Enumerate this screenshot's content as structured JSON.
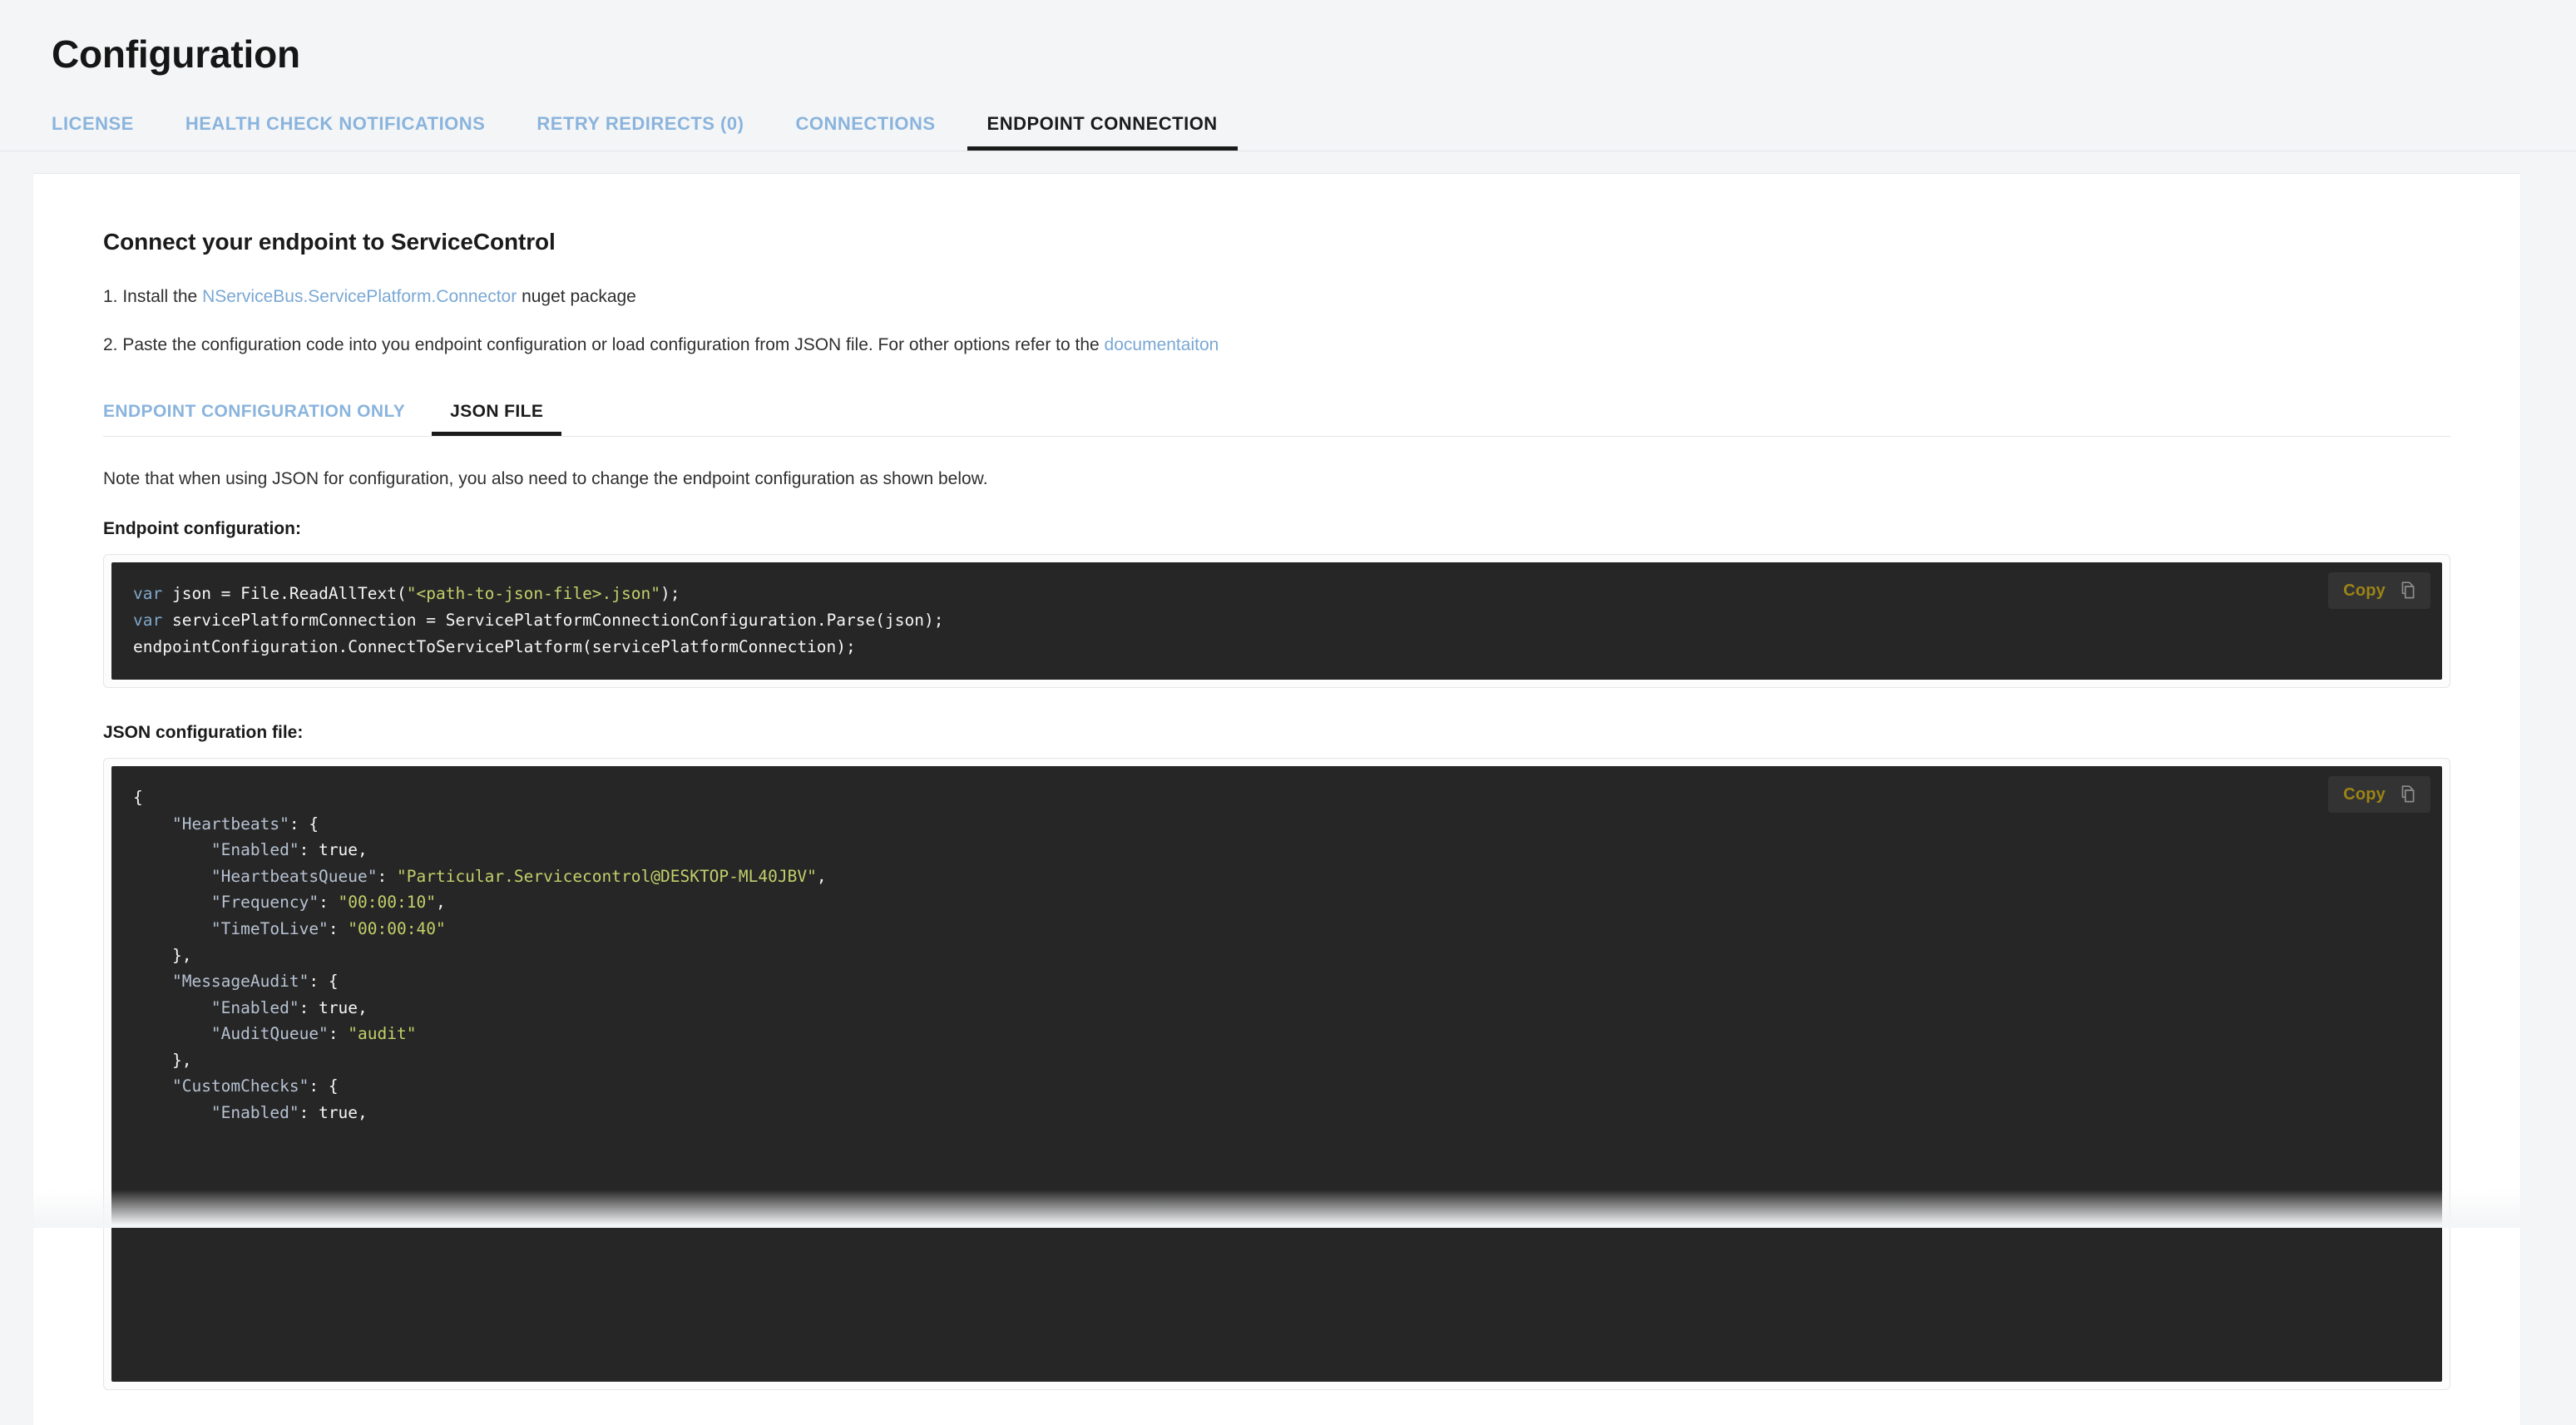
{
  "header": {
    "title": "Configuration"
  },
  "tabs": [
    {
      "label": "LICENSE",
      "active": false
    },
    {
      "label": "HEALTH CHECK NOTIFICATIONS",
      "active": false
    },
    {
      "label": "RETRY REDIRECTS (0)",
      "active": false
    },
    {
      "label": "CONNECTIONS",
      "active": false
    },
    {
      "label": "ENDPOINT CONNECTION",
      "active": true
    }
  ],
  "main": {
    "section_title": "Connect your endpoint to ServiceControl",
    "steps": [
      {
        "number": "1.",
        "text_before": " Install the ",
        "link": "NServiceBus.ServicePlatform.Connector",
        "text_after": " nuget package"
      },
      {
        "number": "2.",
        "text_before": " Paste the configuration code into you endpoint configuration or load configuration from JSON file. For other options refer to the ",
        "link": "documentaiton",
        "text_after": ""
      }
    ],
    "subtabs": [
      {
        "label": "ENDPOINT CONFIGURATION ONLY",
        "active": false
      },
      {
        "label": "JSON FILE",
        "active": true
      }
    ],
    "note": "Note that when using JSON for configuration, you also need to change the endpoint configuration as shown below.",
    "endpoint_config_label": "Endpoint configuration:",
    "json_config_label": "JSON configuration file:",
    "copy_label": "Copy",
    "endpoint_code": "var json = File.ReadAllText(\"<path-to-json-file>.json\");\nvar servicePlatformConnection = ServicePlatformConnectionConfiguration.Parse(json);\nendpointConfiguration.ConnectToServicePlatform(servicePlatformConnection);",
    "json_code": "{\n    \"Heartbeats\": {\n        \"Enabled\": true,\n        \"HeartbeatsQueue\": \"Particular.Servicecontrol@DESKTOP-ML40JBV\",\n        \"Frequency\": \"00:00:10\",\n        \"TimeToLive\": \"00:00:40\"\n    },\n    \"MessageAudit\": {\n        \"Enabled\": true,\n        \"AuditQueue\": \"audit\"\n    },\n    \"CustomChecks\": {\n        \"Enabled\": true,"
  },
  "colors": {
    "page_background": "#f4f5f7",
    "card_background": "#ffffff",
    "tab_inactive": "#8ab4dd",
    "tab_active": "#1b1b1b",
    "link": "#7aa8d4",
    "code_background": "#262626",
    "copy_label": "#9c8416",
    "code_keyword": "#7fa8c9",
    "code_string": "#c3cf6a",
    "code_property": "#b6c2d2"
  },
  "icons": {
    "copy": "copy-icon"
  }
}
